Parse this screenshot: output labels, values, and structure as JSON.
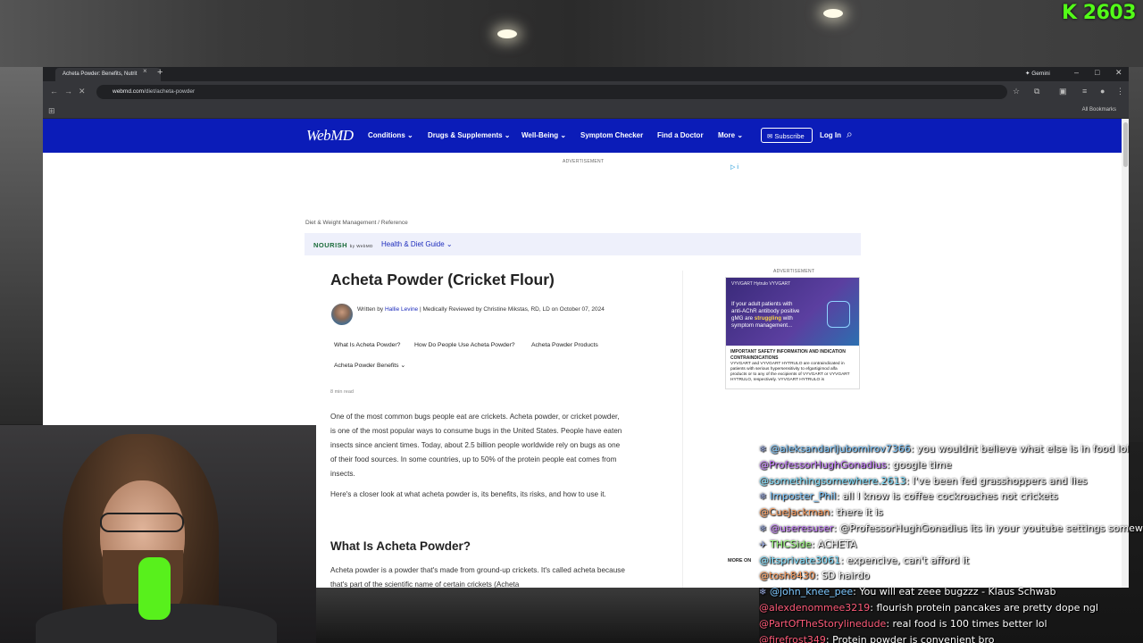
{
  "stream": {
    "kick_count": "2603"
  },
  "browser": {
    "tab_title": "Acheta Powder: Benefits, Nutrit",
    "tab_close": "×",
    "new_tab": "+",
    "gemini_label": "✦ Gemini",
    "url_host": "webmd.com",
    "url_path": "/diet/acheta-powder",
    "all_bookmarks": "All Bookmarks"
  },
  "webmd": {
    "logo": "WebMD",
    "nav": [
      "Conditions ⌄",
      "Drugs & Supplements ⌄",
      "Well-Being ⌄",
      "Symptom Checker",
      "Find a Doctor",
      "More ⌄"
    ],
    "subscribe": "✉ Subscribe",
    "login": "Log In",
    "advertisement": "ADVERTISEMENT",
    "breadcrumb": "Diet & Weight Management / Reference",
    "nourish": "NOURISH",
    "nourish_by": "by WebMD",
    "guide": "Health & Diet Guide  ⌄",
    "title": "Acheta Powder (Cricket Flour)",
    "byline_written": "Written by ",
    "author": "Hallie Levine",
    "byline_rest": " | Medically Reviewed by Christine Mikstas, RD, LD on October 07, 2024",
    "toc": [
      "What Is Acheta Powder?",
      "How Do People Use Acheta Powder?",
      "Acheta Powder Products",
      "Acheta Powder Benefits  ⌄"
    ],
    "read_time": "8 min read",
    "para1": "One of the most common bugs people eat are crickets. Acheta powder, or cricket powder, is one of the most popular ways to consume bugs in the United States. People have eaten insects since ancient times. Today, about 2.5 billion people worldwide rely on bugs as one of their food sources. In some countries, up to 50% of the protein people eat comes from insects.",
    "para2": "Here's a closer look at what acheta powder is, its benefits, its risks, and how to use it.",
    "h2": "What Is Acheta Powder?",
    "para3": "Acheta powder is a powder that's made from ground-up crickets. It's called acheta because that's part of the scientific name of certain crickets (Acheta",
    "more_on": "MORE ON",
    "side_ad": {
      "brands": "VYVGART Hytrulo   VYVGART",
      "message_a": "If your adult patients with anti-AChR antibody positive gMG are ",
      "message_b": "struggling",
      "message_c": " with symptom management...",
      "safety_title": "IMPORTANT SAFETY INFORMATION AND INDICATION CONTRAINDICATIONS",
      "safety_text": "VYVGART and VYVGART HYTRULO are contraindicated in patients with serious hypersensitivity to efgartigimod alfa products or to any of the excipients of VYVGART or VYVGART HYTRULO, respectively. VYVGART HYTRULO is"
    }
  },
  "chat": [
    {
      "user": "@aleksandarljubomirov7366",
      "color": "#7ec8ff",
      "text": ": you wouldnt believe what else is in food lol",
      "badge": "❄"
    },
    {
      "user": "@ProfessorHughGonadius",
      "color": "#c77dff",
      "text": ": google time",
      "badge": ""
    },
    {
      "user": "@somethingsomewhere.2613",
      "color": "#7ee0ff",
      "text": ": I've been fed grasshoppers and lies",
      "badge": ""
    },
    {
      "user": "Imposter_Phil",
      "color": "#7ec8ff",
      "text": ": all I know is coffee cockroaches not crickets",
      "badge": "❄"
    },
    {
      "user": "@CueJackman",
      "color": "#ff9d5c",
      "text": ": there it is",
      "badge": ""
    },
    {
      "user": "@useresuser",
      "color": "#c77dff",
      "text": ": @ProfessorHughGonadius its in your youtube settings somewhere",
      "badge": "❄"
    },
    {
      "user": "THCSide",
      "color": "#9dff7e",
      "text": ": ACHETA",
      "badge": "✈"
    },
    {
      "user": "@itsprivate3061",
      "color": "#7ee0ff",
      "text": ": expencive, can't afford it",
      "badge": ""
    },
    {
      "user": "@tosh8430",
      "color": "#ff9d5c",
      "text": ": SD hairdo",
      "badge": ""
    },
    {
      "user": "@john_knee_pee",
      "color": "#7ec8ff",
      "text": ": You will eat zeee bugzzz - Klaus Schwab",
      "badge": "❄"
    },
    {
      "user": "@alexdenommee3219",
      "color": "#ff5c7a",
      "text": ": flourish protein pancakes are pretty dope ngl",
      "badge": ""
    },
    {
      "user": "@PartOfTheStorylinedude",
      "color": "#ff5c7a",
      "text": ": real food is 100 times better lol",
      "badge": ""
    },
    {
      "user": "@firefrost349",
      "color": "#ff5c7a",
      "text": ": Protein powder is convenient bro",
      "badge": ""
    }
  ]
}
